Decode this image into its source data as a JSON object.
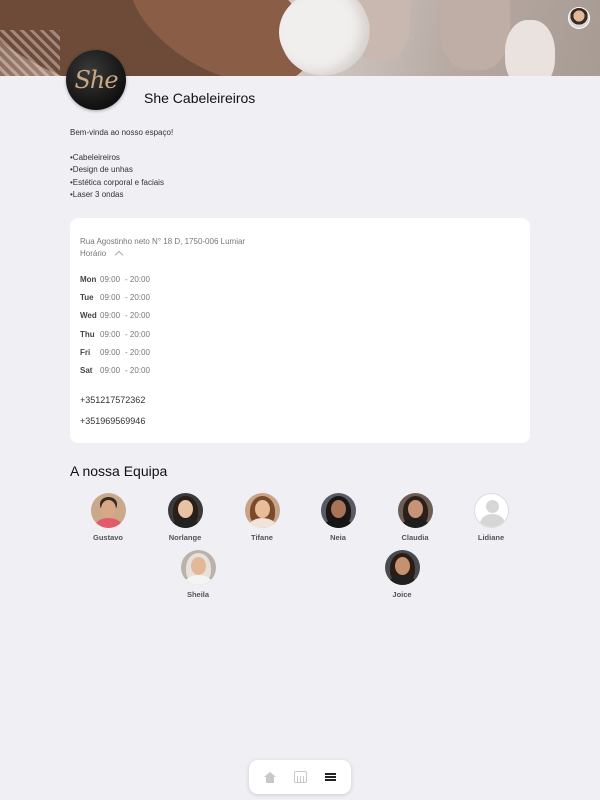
{
  "business": {
    "name": "She Cabeleireiros",
    "logo_text": "She",
    "welcome": "Bem-vinda ao nosso espaço!",
    "services": [
      "•Cabeleireiros",
      "•Design de unhas",
      "•Estética corporal e faciais",
      "•Laser 3 ondas"
    ]
  },
  "info": {
    "address": "Rua Agostinho neto N° 18 D, 1750-006 Lumiar",
    "hours_label": "Horário",
    "hours": [
      {
        "day": "Mon",
        "open": "09:00",
        "close": "- 20:00"
      },
      {
        "day": "Tue",
        "open": "09:00",
        "close": "- 20:00"
      },
      {
        "day": "Wed",
        "open": "09:00",
        "close": "- 20:00"
      },
      {
        "day": "Thu",
        "open": "09:00",
        "close": "- 20:00"
      },
      {
        "day": "Fri",
        "open": "09:00",
        "close": "- 20:00"
      },
      {
        "day": "Sat",
        "open": "09:00",
        "close": "- 20:00"
      }
    ],
    "phones": [
      "+351217572362",
      "+351969569946"
    ]
  },
  "team": {
    "title": "A nossa Equipa",
    "members": [
      "Gustavo",
      "Norlange",
      "Tifane",
      "Neia",
      "Claudia",
      "Lidiane",
      "Sheila",
      "Joice"
    ]
  },
  "nav": {
    "icons": [
      "home-icon",
      "calendar-icon",
      "menu-icon"
    ]
  }
}
